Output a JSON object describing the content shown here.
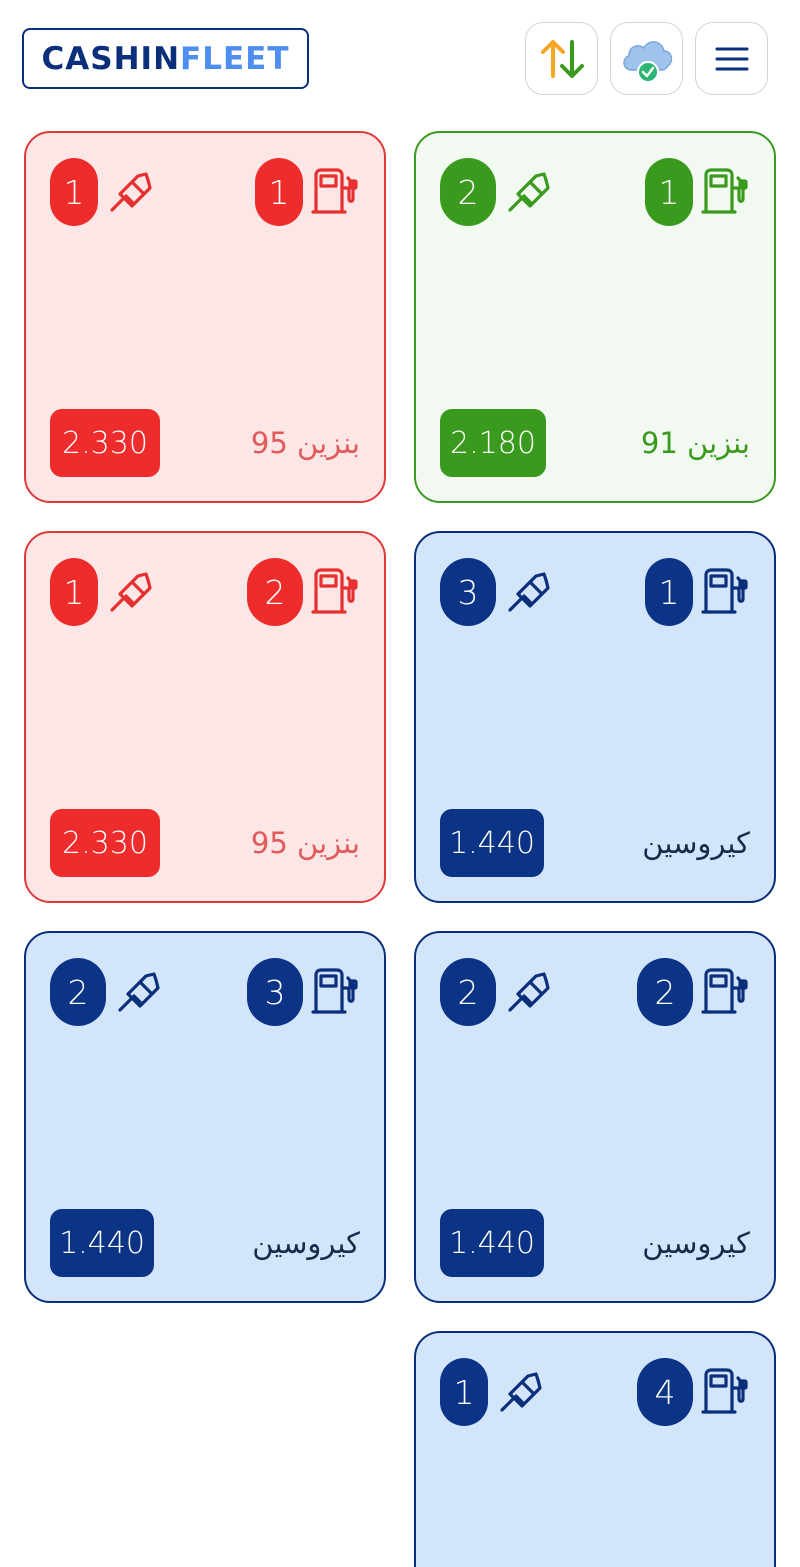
{
  "header": {
    "logo_part1": "CASHIN",
    "logo_part2": "FLEET",
    "icons": [
      "sync-arrows-icon",
      "cloud-check-icon",
      "hamburger-menu-icon"
    ]
  },
  "colors": {
    "red": "#ee2c2c",
    "green": "#3a9a1d",
    "blue": "#0b3487",
    "arrow_up": "#f5a623",
    "arrow_down": "#3a9a1d",
    "cloud": "#9ec4ee",
    "cloud_check": "#2bb673"
  },
  "pumps": [
    {
      "nozzle": "2",
      "pump": "1",
      "fuel": "بنزين 91",
      "price": "2.180",
      "status": "green"
    },
    {
      "nozzle": "1",
      "pump": "1",
      "fuel": "بنزين 95",
      "price": "2.330",
      "status": "red"
    },
    {
      "nozzle": "3",
      "pump": "1",
      "fuel": "كيروسين",
      "price": "1.440",
      "status": "blue"
    },
    {
      "nozzle": "1",
      "pump": "2",
      "fuel": "بنزين 95",
      "price": "2.330",
      "status": "red"
    },
    {
      "nozzle": "2",
      "pump": "2",
      "fuel": "كيروسين",
      "price": "1.440",
      "status": "blue"
    },
    {
      "nozzle": "2",
      "pump": "3",
      "fuel": "كيروسين",
      "price": "1.440",
      "status": "blue"
    },
    {
      "nozzle": "1",
      "pump": "4",
      "fuel": "",
      "price": "",
      "status": "blue"
    }
  ]
}
